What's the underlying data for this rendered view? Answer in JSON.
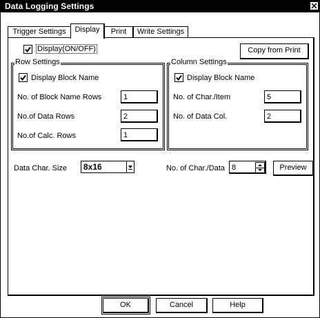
{
  "window": {
    "title": "Data Logging Settings"
  },
  "tabs": [
    {
      "label": "Trigger Settings"
    },
    {
      "label": "Display"
    },
    {
      "label": "Print"
    },
    {
      "label": "Write Settings"
    }
  ],
  "display_toggle": {
    "label": "Display(ON/OFF)",
    "checked": true
  },
  "copy_from_print": "Copy from Print",
  "row_settings": {
    "title": "Row Settings",
    "display_block_name": "Display Block Name",
    "block_name_rows_label": "No. of Block Name Rows",
    "block_name_rows_value": "1",
    "data_rows_label": "No.of Data Rows",
    "data_rows_value": "2",
    "calc_rows_label": "No.of Calc. Rows",
    "calc_rows_value": "1"
  },
  "column_settings": {
    "title": "Column Settings",
    "display_block_name": "Display Block Name",
    "char_item_label": "No. of Char./Item",
    "char_item_value": "5",
    "data_col_label": "No. of Data Col.",
    "data_col_value": "2"
  },
  "data_char_size": {
    "label": "Data Char. Size",
    "value": "8x16"
  },
  "char_per_data": {
    "label": "No. of Char./Data",
    "value": "8"
  },
  "preview": "Preview",
  "footer": {
    "ok": "OK",
    "cancel": "Cancel",
    "help": "Help"
  },
  "icons": {
    "close": "close-icon",
    "check": "check-icon",
    "dropdown": "dropdown-arrow-icon",
    "spin_up": "spin-up-icon",
    "spin_down": "spin-down-icon"
  }
}
